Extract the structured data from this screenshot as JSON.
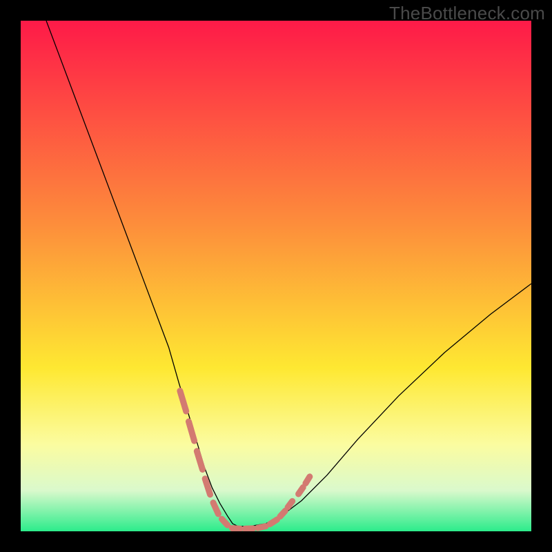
{
  "watermark": "TheBottleneck.com",
  "chart_data": {
    "type": "line",
    "title": "",
    "xlabel": "",
    "ylabel": "",
    "xlim": [
      0,
      100
    ],
    "ylim": [
      0,
      100
    ],
    "legend": false,
    "grid": false,
    "background_gradient": {
      "top": "#fe1a48",
      "mid1": "#fd8e3b",
      "mid2": "#fee832",
      "mid3": "#fbfca0",
      "mid4": "#daf9cc",
      "bottom": "#2cec8b"
    },
    "series": [
      {
        "name": "bottleneck-curve",
        "color": "#000000",
        "width": 1.3,
        "x": [
          5,
          8,
          11,
          14,
          17,
          20,
          23,
          26,
          29,
          31,
          33,
          34.5,
          36,
          37.5,
          39,
          40.5,
          41.5,
          42.5,
          45,
          48,
          51,
          55,
          60,
          66,
          74,
          83,
          92,
          100
        ],
        "y": [
          100,
          92,
          84,
          76,
          68,
          60,
          52,
          44,
          36,
          29,
          22.5,
          17.5,
          12.5,
          8.5,
          5.5,
          3,
          1.5,
          1,
          1,
          1.5,
          3,
          6,
          11,
          18,
          26.5,
          35,
          42.5,
          48.5
        ]
      },
      {
        "name": "highlight-dashes",
        "color": "#d37a71",
        "width": 9,
        "linecap": "round",
        "segments": [
          {
            "x": [
              31.2,
              32.4
            ],
            "y": [
              27.5,
              23.5
            ]
          },
          {
            "x": [
              32.9,
              34.0
            ],
            "y": [
              21.5,
              17.7
            ]
          },
          {
            "x": [
              34.5,
              35.6
            ],
            "y": [
              15.7,
              12.1
            ]
          },
          {
            "x": [
              36.1,
              37.1
            ],
            "y": [
              10.3,
              7.2
            ]
          },
          {
            "x": [
              37.7,
              38.7
            ],
            "y": [
              5.6,
              3.4
            ]
          },
          {
            "x": [
              39.4,
              40.5
            ],
            "y": [
              2.4,
              1.2
            ]
          },
          {
            "x": [
              41.4,
              43.0
            ],
            "y": [
              0.6,
              0.5
            ]
          },
          {
            "x": [
              43.9,
              45.5
            ],
            "y": [
              0.5,
              0.55
            ]
          },
          {
            "x": [
              46.4,
              48.0
            ],
            "y": [
              0.65,
              1.0
            ]
          },
          {
            "x": [
              48.8,
              50.2
            ],
            "y": [
              1.4,
              2.3
            ]
          },
          {
            "x": [
              50.8,
              51.8
            ],
            "y": [
              2.9,
              4.0
            ]
          },
          {
            "x": [
              52.3,
              53.2
            ],
            "y": [
              4.7,
              5.9
            ]
          },
          {
            "x": [
              54.4,
              55.3
            ],
            "y": [
              7.3,
              8.6
            ]
          },
          {
            "x": [
              55.8,
              56.6
            ],
            "y": [
              9.4,
              10.7
            ]
          }
        ]
      }
    ]
  }
}
